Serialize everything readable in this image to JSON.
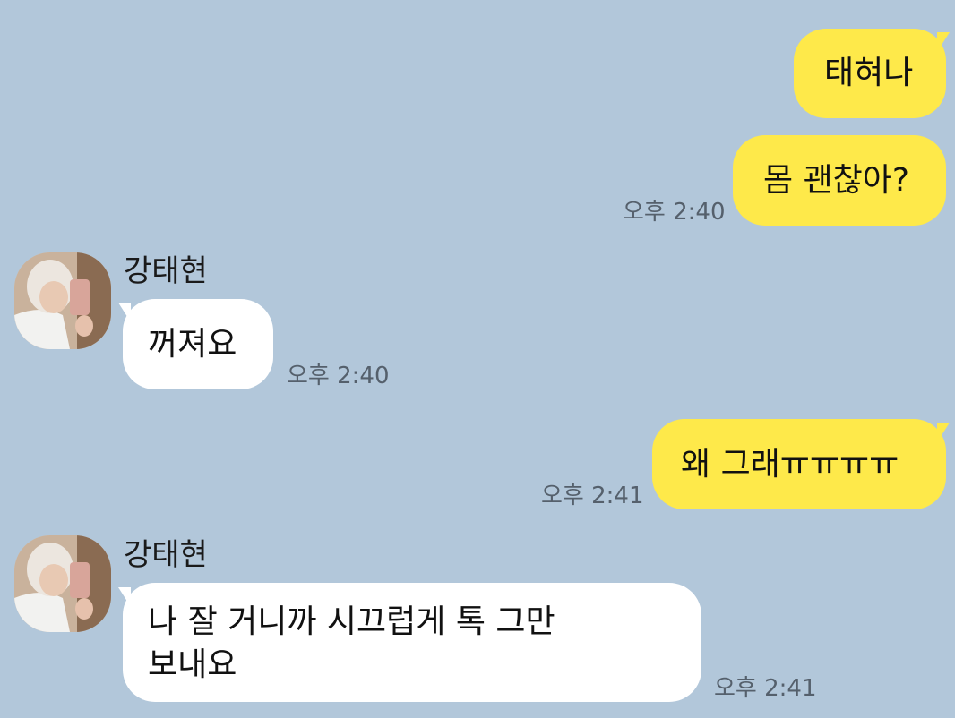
{
  "messages": [
    {
      "side": "me",
      "text": "태혀나"
    },
    {
      "side": "me",
      "text": "몸 괜찮아?",
      "time": "오후 2:40"
    },
    {
      "side": "them",
      "sender": "강태현",
      "text": "꺼져요",
      "time": "오후 2:40",
      "avatar_icon": "profile-photo-icon"
    },
    {
      "side": "me",
      "text": "왜 그래ㅠㅠㅠㅠ",
      "time": "오후 2:41"
    },
    {
      "side": "them",
      "sender": "강태현",
      "text_lines": [
        "나 잘 거니까 시끄럽게 톡 그만",
        "보내요"
      ],
      "time": "오후 2:41",
      "avatar_icon": "profile-photo-icon"
    }
  ],
  "colors": {
    "background": "#b2c7da",
    "my_bubble": "#fee94a",
    "their_bubble": "#ffffff",
    "timestamp": "#55606c"
  }
}
